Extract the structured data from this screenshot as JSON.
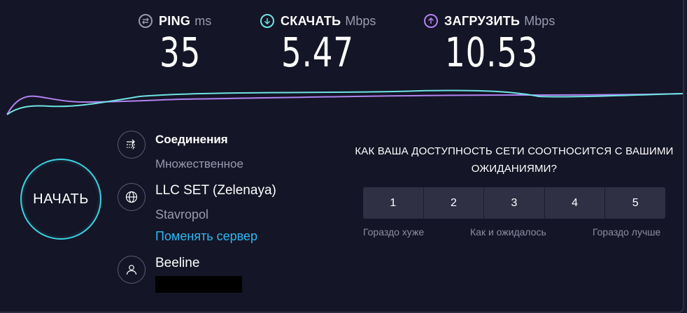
{
  "metrics": {
    "ping": {
      "label": "PING",
      "unit": "ms",
      "value": "35"
    },
    "download": {
      "label": "СКАЧАТЬ",
      "unit": "Mbps",
      "value": "5.47"
    },
    "upload": {
      "label": "ЗАГРУЗИТЬ",
      "unit": "Mbps",
      "value": "10.53"
    }
  },
  "colors": {
    "download": "#6fe3e3",
    "upload": "#b283f2",
    "link": "#2fb8f2",
    "start_ring": "#3cd3e3"
  },
  "start_label": "НАЧАТЬ",
  "connections": {
    "title": "Соединения",
    "value": "Множественное",
    "icon": "arrows-icon"
  },
  "server": {
    "name": "LLC SET (Zelenaya)",
    "city": "Stavropol",
    "change_link": "Поменять сервер",
    "icon": "globe-icon"
  },
  "isp": {
    "name": "Beeline",
    "icon": "user-icon"
  },
  "survey": {
    "question": "КАК ВАША ДОСТУПНОСТЬ СЕТИ СООТНОСИТСЯ С ВАШИМИ ОЖИДАНИЯМИ?",
    "options": [
      "1",
      "2",
      "3",
      "4",
      "5"
    ],
    "scale_low": "Гораздо хуже",
    "scale_mid": "Как и ожидалось",
    "scale_high": "Гораздо лучше"
  }
}
